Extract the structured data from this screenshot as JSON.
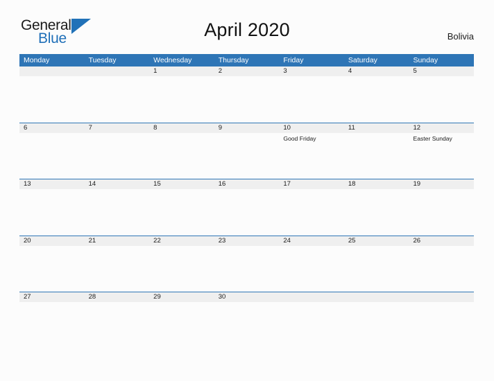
{
  "brand": {
    "name_top": "General",
    "name_bottom": "Blue",
    "accent_color": "#2172b8"
  },
  "header": {
    "title": "April 2020",
    "country": "Bolivia"
  },
  "calendar": {
    "header_bg": "#2e75b6",
    "date_band_bg": "#efefef",
    "weekdays": [
      "Monday",
      "Tuesday",
      "Wednesday",
      "Thursday",
      "Friday",
      "Saturday",
      "Sunday"
    ],
    "weeks": [
      [
        {
          "num": "",
          "events": []
        },
        {
          "num": "",
          "events": []
        },
        {
          "num": "1",
          "events": []
        },
        {
          "num": "2",
          "events": []
        },
        {
          "num": "3",
          "events": []
        },
        {
          "num": "4",
          "events": []
        },
        {
          "num": "5",
          "events": []
        }
      ],
      [
        {
          "num": "6",
          "events": []
        },
        {
          "num": "7",
          "events": []
        },
        {
          "num": "8",
          "events": []
        },
        {
          "num": "9",
          "events": []
        },
        {
          "num": "10",
          "events": [
            "Good Friday"
          ]
        },
        {
          "num": "11",
          "events": []
        },
        {
          "num": "12",
          "events": [
            "Easter Sunday"
          ]
        }
      ],
      [
        {
          "num": "13",
          "events": []
        },
        {
          "num": "14",
          "events": []
        },
        {
          "num": "15",
          "events": []
        },
        {
          "num": "16",
          "events": []
        },
        {
          "num": "17",
          "events": []
        },
        {
          "num": "18",
          "events": []
        },
        {
          "num": "19",
          "events": []
        }
      ],
      [
        {
          "num": "20",
          "events": []
        },
        {
          "num": "21",
          "events": []
        },
        {
          "num": "22",
          "events": []
        },
        {
          "num": "23",
          "events": []
        },
        {
          "num": "24",
          "events": []
        },
        {
          "num": "25",
          "events": []
        },
        {
          "num": "26",
          "events": []
        }
      ],
      [
        {
          "num": "27",
          "events": []
        },
        {
          "num": "28",
          "events": []
        },
        {
          "num": "29",
          "events": []
        },
        {
          "num": "30",
          "events": []
        },
        {
          "num": "",
          "events": []
        },
        {
          "num": "",
          "events": []
        },
        {
          "num": "",
          "events": []
        }
      ]
    ]
  }
}
